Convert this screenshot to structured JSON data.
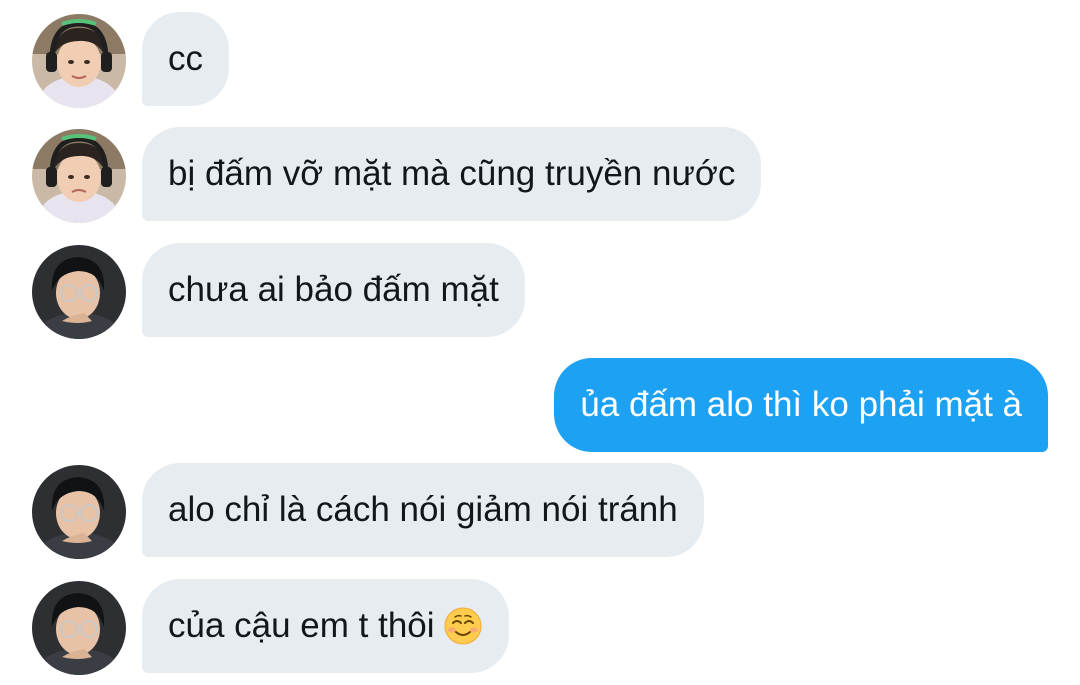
{
  "conversation": {
    "messages": [
      {
        "sender": "other",
        "avatar": "avatar-headphones",
        "text": "cc"
      },
      {
        "sender": "other",
        "avatar": "avatar-headphones",
        "text": "bị đấm vỡ mặt mà cũng truyền nước"
      },
      {
        "sender": "other",
        "avatar": "avatar-glasses",
        "text": "chưa ai bảo đấm mặt"
      },
      {
        "sender": "me",
        "text": "ủa đấm alo thì ko phải mặt à"
      },
      {
        "sender": "other",
        "avatar": "avatar-glasses",
        "text": "alo chỉ là cách nói giảm nói tránh"
      },
      {
        "sender": "other",
        "avatar": "avatar-glasses",
        "text": "của cậu em t thôi",
        "emoji": "smiling-face-icon"
      }
    ]
  },
  "colors": {
    "incoming_bubble": "#e6ecf0",
    "outgoing_bubble": "#1da1f2",
    "incoming_text": "#14171a",
    "outgoing_text": "#ffffff"
  }
}
